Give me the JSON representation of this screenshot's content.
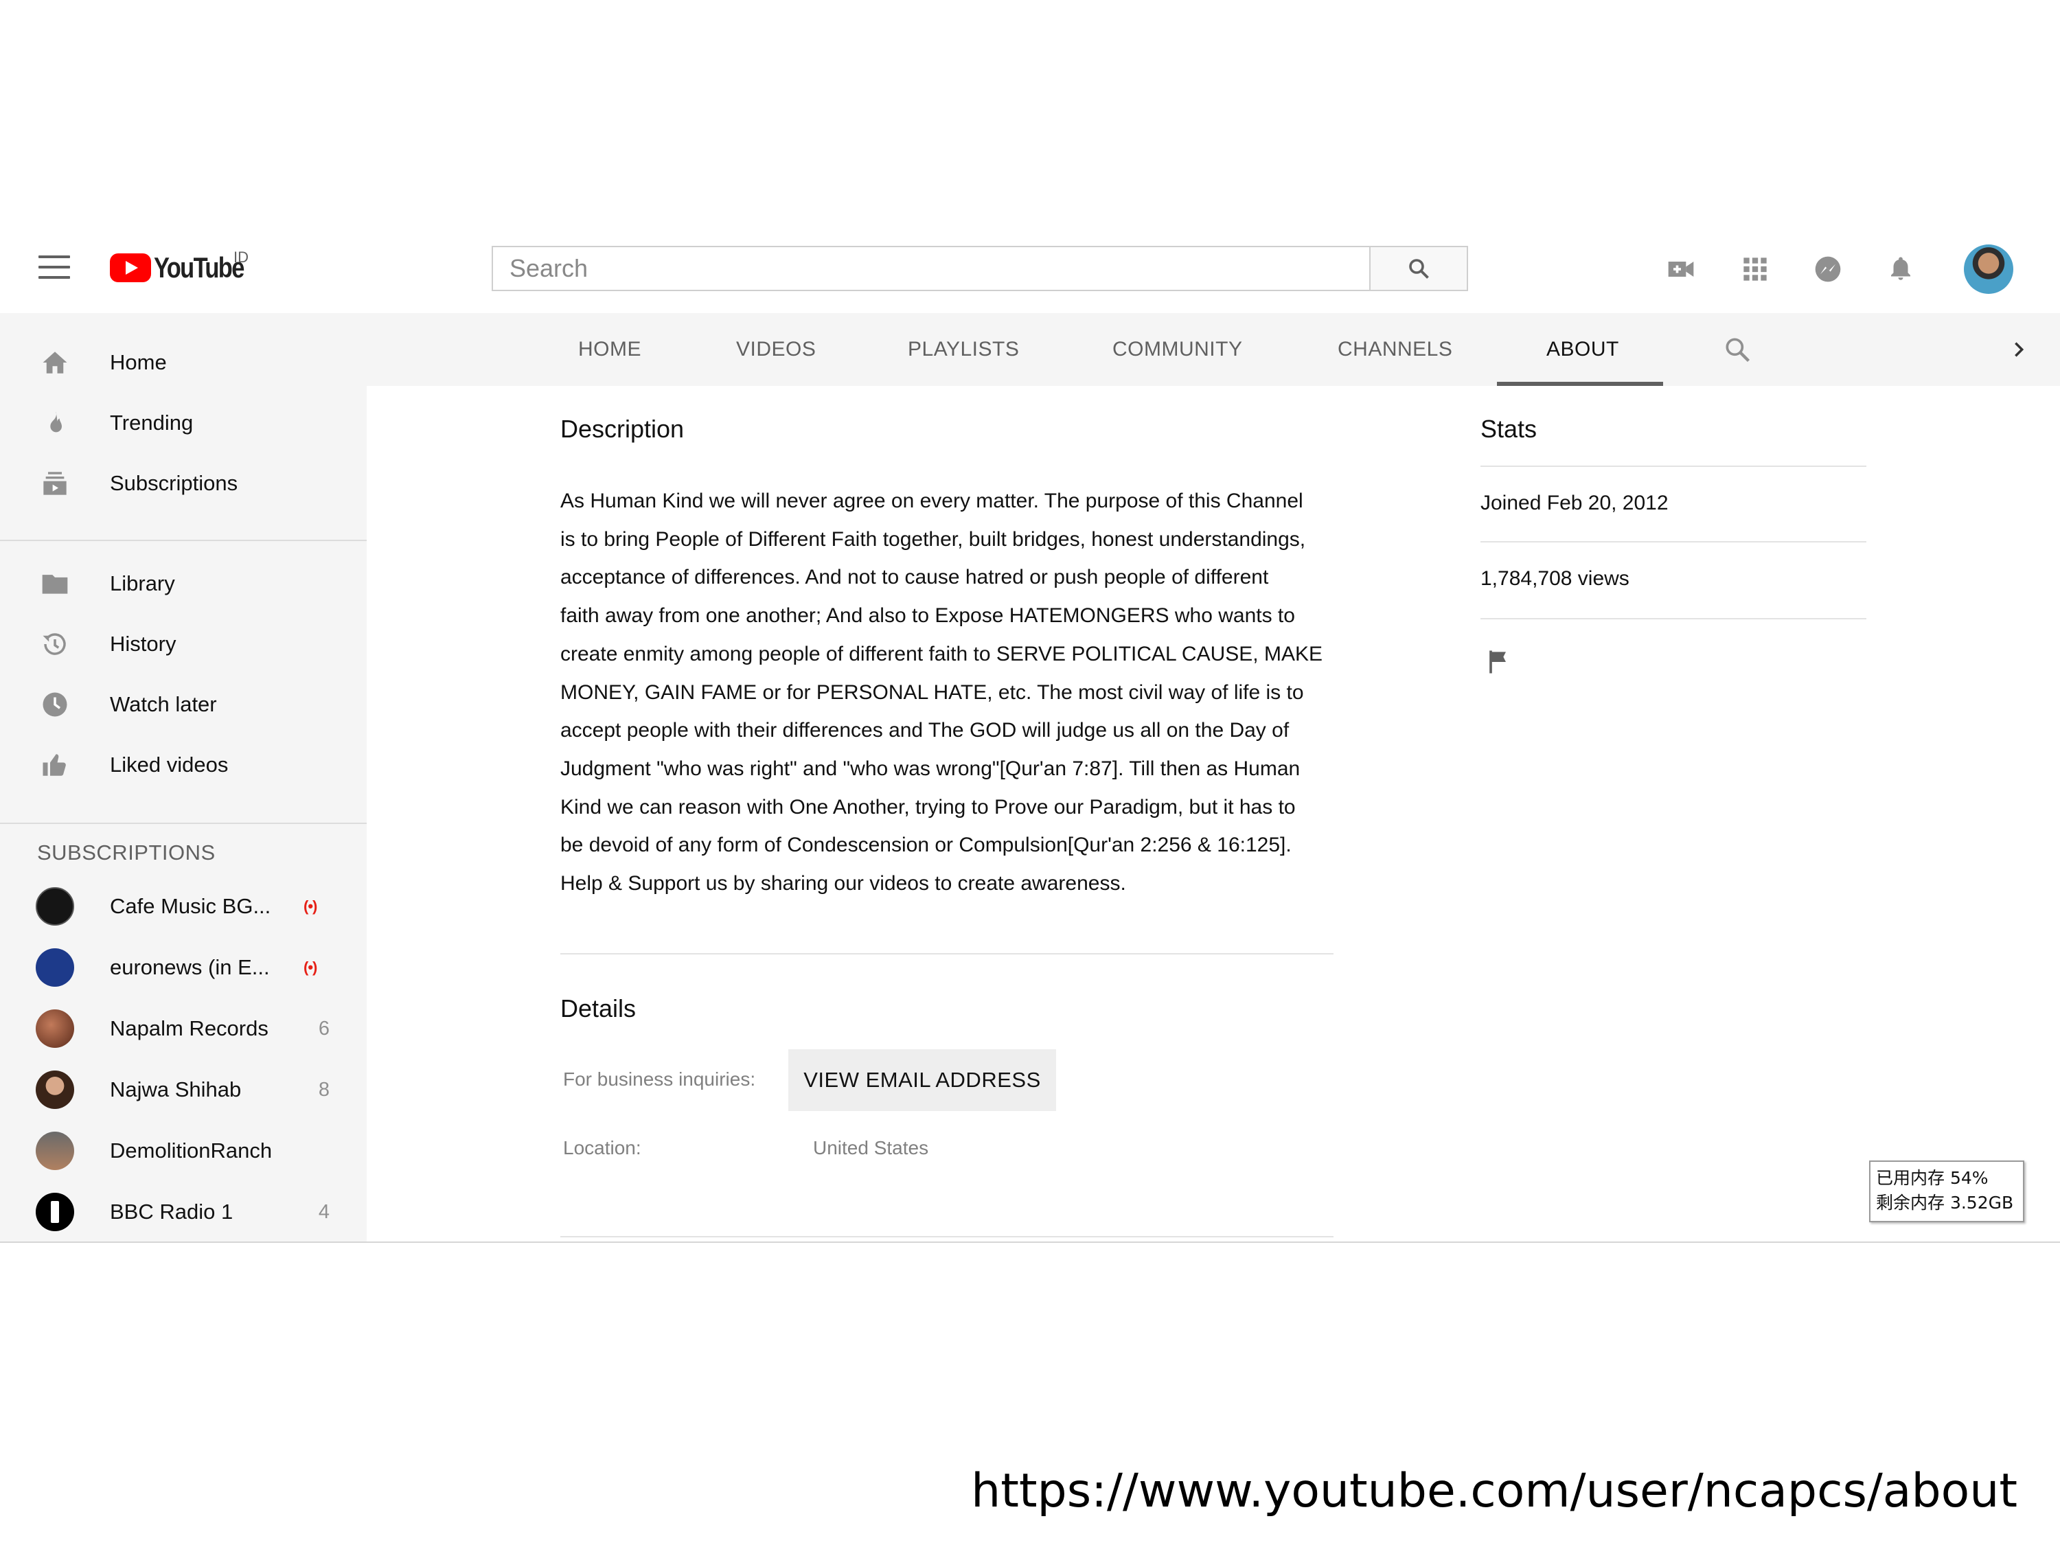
{
  "masthead": {
    "logo_text": "YouTube",
    "country_code": "ID",
    "search_placeholder": "Search",
    "icons": [
      "menu-icon",
      "create-video-icon",
      "apps-icon",
      "messages-icon",
      "notifications-icon",
      "account-avatar"
    ]
  },
  "sidebar": {
    "main_items": [
      {
        "label": "Home",
        "icon": "home-icon"
      },
      {
        "label": "Trending",
        "icon": "flame-icon"
      },
      {
        "label": "Subscriptions",
        "icon": "subscriptions-icon"
      }
    ],
    "library_items": [
      {
        "label": "Library",
        "icon": "folder-icon"
      },
      {
        "label": "History",
        "icon": "history-icon"
      },
      {
        "label": "Watch later",
        "icon": "clock-icon"
      },
      {
        "label": "Liked videos",
        "icon": "thumbs-up-icon"
      }
    ],
    "subscriptions_heading": "SUBSCRIPTIONS",
    "subscriptions": [
      {
        "label": "Cafe Music BG...",
        "badge": "(•)",
        "live": true,
        "color": "#1a1a1a"
      },
      {
        "label": "euronews (in E...",
        "badge": "(•)",
        "live": true,
        "color": "#1d3a8a"
      },
      {
        "label": "Napalm Records",
        "badge": "6",
        "live": false,
        "color": "#7a3a2a"
      },
      {
        "label": "Najwa Shihab",
        "badge": "8",
        "live": false,
        "color": "#4a3326"
      },
      {
        "label": "DemolitionRanch",
        "badge": "",
        "live": false,
        "color": "#8a6a4a"
      },
      {
        "label": "BBC Radio 1",
        "badge": "4",
        "live": false,
        "color": "#000000"
      }
    ]
  },
  "tabs": [
    "HOME",
    "VIDEOS",
    "PLAYLISTS",
    "COMMUNITY",
    "CHANNELS",
    "ABOUT"
  ],
  "active_tab": "ABOUT",
  "about": {
    "description_heading": "Description",
    "description_lines": [
      "As Human Kind we will never agree on every matter. The purpose of this Channel",
      "is to bring People of Different Faith together, built bridges, honest understandings,",
      "acceptance of differences. And not to cause hatred or push people of different",
      "faith away from one another; And also to Expose HATEMONGERS who wants to",
      "create enmity among people of different faith to SERVE POLITICAL CAUSE, MAKE",
      "MONEY, GAIN FAME or for PERSONAL HATE, etc. The most civil way of life is to",
      "accept people with their differences and The GOD will judge us all on the Day of",
      "Judgment \"who was right\" and \"who was wrong\"[Qur'an 7:87]. Till then as Human",
      "Kind we can reason with One Another, trying to Prove our Paradigm, but it has to",
      "be devoid of any form of Condescension or Compulsion[Qur'an 2:256 & 16:125].",
      "Help & Support us by sharing our videos to create awareness."
    ],
    "details_heading": "Details",
    "business_label": "For business inquiries:",
    "email_button": "VIEW EMAIL ADDRESS",
    "location_label": "Location:",
    "location_value": "United States",
    "stats_heading": "Stats",
    "joined": "Joined Feb 20, 2012",
    "views": "1,784,708 views"
  },
  "memory_widget": {
    "used": "已用内存 54%",
    "free": "剩余内存 3.52GB"
  },
  "caption_url": "https://www.youtube.com/user/ncapcs/about",
  "colors": {
    "brand_red": "#ff0000",
    "live_red": "#e62117",
    "sidebar_bg": "#f5f5f5"
  }
}
